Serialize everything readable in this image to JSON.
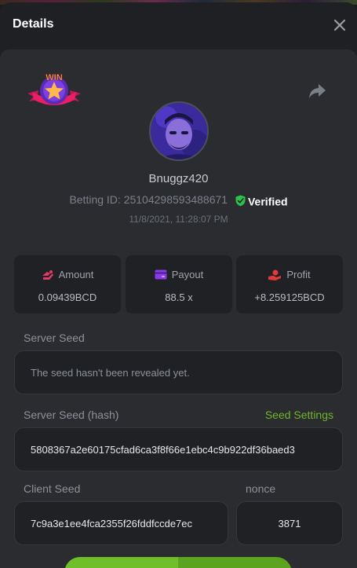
{
  "header": {
    "title": "Details",
    "close_label": "×"
  },
  "badge": {
    "text": "WIN"
  },
  "user": {
    "name": "Bnuggz420",
    "betting_prefix": "Betting ID: ",
    "betting_id": "25104298593488671",
    "verified": "Verified",
    "timestamp": "11/8/2021, 11:28:07 PM"
  },
  "stats": [
    {
      "label": "Amount",
      "value": "0.09439BCD",
      "icon": "coins-icon",
      "color": "#e23a6a"
    },
    {
      "label": "Payout",
      "value": "88.5 x",
      "icon": "card-icon",
      "color": "#8a3be8"
    },
    {
      "label": "Profit",
      "value": "+8.259125BCD",
      "icon": "hand-coin-icon",
      "color": "#e23a3a"
    }
  ],
  "server_seed": {
    "label": "Server Seed",
    "value": "The seed hasn't been revealed yet."
  },
  "server_seed_hash": {
    "label": "Server Seed (hash)",
    "link": "Seed Settings",
    "value": "5808367a2e60175cfad6ca3f8f66e1ebc4c9b922df36baed3"
  },
  "client_seed": {
    "label": "Client Seed",
    "value": "7c9a3e1ee4fca2355f26fddfccde7ec"
  },
  "nonce": {
    "label": "nonce",
    "value": "3871"
  },
  "colors": {
    "accent": "#6fbf2a",
    "verified": "#2fc24a"
  }
}
